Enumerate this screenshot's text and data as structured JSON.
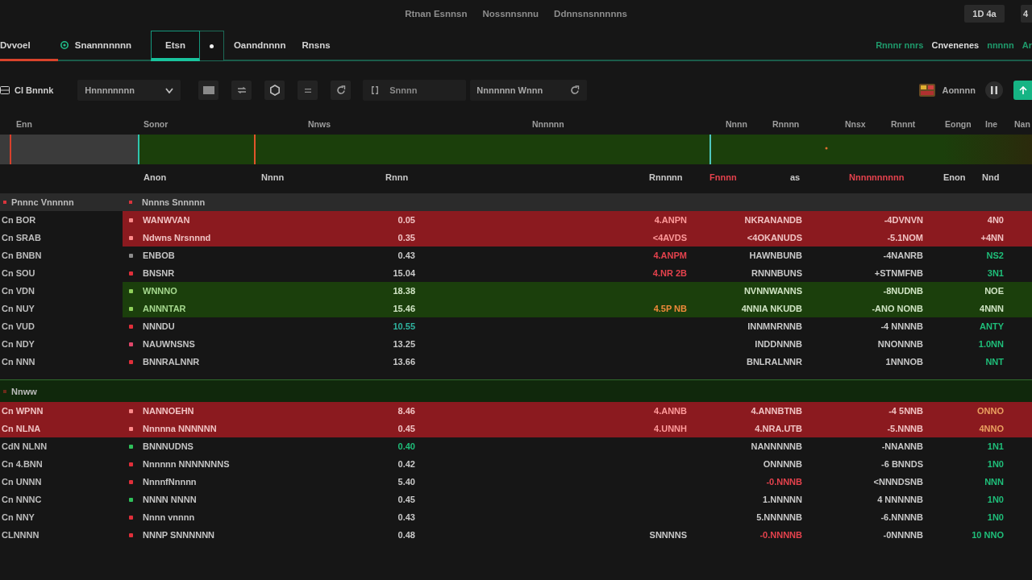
{
  "top_bar": {
    "links": [
      "Rtnan Esnnsn",
      "Nossnnsnnu",
      "Ddnnsnsnnnnns"
    ],
    "buttons": [
      "1D 4a",
      "4"
    ]
  },
  "tabs": [
    {
      "label": "Dvvoel",
      "selected": false,
      "alert": true,
      "kind": "plain"
    },
    {
      "label": "Snannnnnnn",
      "selected": false,
      "alert": false,
      "kind": "icon"
    },
    {
      "label": "Etsn",
      "selected": true,
      "alert": false,
      "kind": "plain"
    },
    {
      "label": "Oanndnnnn",
      "selected": false,
      "alert": false,
      "kind": "plain"
    },
    {
      "label": "Rnsns",
      "selected": false,
      "alert": false,
      "kind": "plain"
    }
  ],
  "view_links": [
    {
      "label": "Rnnnr nnrs",
      "selected": false
    },
    {
      "label": "Cnvenenes",
      "selected": true
    },
    {
      "label": "nnnnn",
      "selected": false
    },
    {
      "label": "Ar",
      "selected": false
    }
  ],
  "toolbar": {
    "account": "Cl Bnnnk",
    "dropdown": "Hnnnnnnnn",
    "search": {
      "placeholder": "Snnnn"
    },
    "filter": {
      "value": "Nnnnnnn Wnnn"
    },
    "user": "Aonnnn"
  },
  "table": {
    "columns": [
      "Enn",
      "Sonor",
      "Nnws",
      "Nnnnnn",
      "Nnnn",
      "Rnnnn",
      "Nnsx",
      "Rnnnt",
      "Eongn",
      "Ine",
      "Nan"
    ],
    "summary": [
      {
        "text": "Anon",
        "color": "#c9c9c9"
      },
      {
        "text": "Nnnn",
        "color": "#c9c9c9"
      },
      {
        "text": "Rnnn",
        "color": "#c9c9c9"
      },
      {
        "text": "Rnnnnn",
        "color": "#c9c9c9"
      },
      {
        "text": "Fnnnn",
        "color": "#e5424d"
      },
      {
        "text": "as",
        "color": "#c9c9c9"
      },
      {
        "text": "Nnnnnnnnnn",
        "color": "#e5424d"
      },
      {
        "text": "Enon",
        "color": "#c9c9c9"
      },
      {
        "text": "Nnd",
        "color": "#c9c9c9"
      }
    ],
    "groups": [
      {
        "kind": "split",
        "labels": [
          {
            "text": "Pnnnc Vnnnnn",
            "color": "#d9343c"
          },
          {
            "text": "Nnnns Snnnnn",
            "color": "#d9343c"
          }
        ],
        "rows": [
          {
            "kind": "loss",
            "col_1": "Cn BOR",
            "col_2": "WANWVAN",
            "color": "#ff8a8a",
            "col_3": {
              "text": "0.05",
              "color": "#f0c3c3"
            },
            "col_4": {
              "text": "4.ANPN",
              "color": "#ff9a9a"
            },
            "col_5": {
              "text": "NKRANANDB",
              "color": "#f0c3c3"
            },
            "col_6": {
              "text": "-4DVNVN",
              "color": "#f0c3c3"
            },
            "col_7": {
              "text": "4N0",
              "color": "#f0c3c3"
            }
          },
          {
            "kind": "loss",
            "col_1": "Cn SRAB",
            "col_2": "Ndwns Nrsnnnd",
            "color": "#ff8a8a",
            "col_3": {
              "text": "0.35",
              "color": "#f0c3c3"
            },
            "col_4": {
              "text": "<4AVDS",
              "color": "#ff9a9a"
            },
            "col_5": {
              "text": "<4OKANUDS",
              "color": "#f0c3c3"
            },
            "col_6": {
              "text": "-5.1NOM",
              "color": "#f0c3c3"
            },
            "col_7": {
              "text": "+4NN",
              "color": "#f0c3c3"
            }
          },
          {
            "kind": "plain",
            "col_1": "Cn BNBN",
            "col_2": "ENBOB",
            "color": "#8c8c8c",
            "col_3": {
              "text": "0.43",
              "color": "#c9c9c9"
            },
            "col_4": {
              "text": "4.ANPM",
              "color": "#e5424d"
            },
            "col_5": {
              "text": "HAWNBUNB",
              "color": "#c9c9c9"
            },
            "col_6": {
              "text": "-4NANRB",
              "color": "#c9c9c9"
            },
            "col_7": {
              "text": "NS2",
              "color": "#1fbf7a"
            }
          },
          {
            "kind": "plain",
            "col_1": "Cn SOU",
            "col_2": "BNSNR",
            "color": "#e02f3a",
            "col_3": {
              "text": "15.04",
              "color": "#c9c9c9"
            },
            "col_4": {
              "text": "4.NR 2B",
              "color": "#e5424d"
            },
            "col_5": {
              "text": "RNNNBUNS",
              "color": "#c9c9c9"
            },
            "col_6": {
              "text": "+STNMFNB",
              "color": "#c9c9c9"
            },
            "col_7": {
              "text": "3N1",
              "color": "#1fbf7a"
            }
          },
          {
            "kind": "gain",
            "col_1": "Cn VDN",
            "col_2": "WNNNO",
            "color": "#8fd05a",
            "col_3": {
              "text": "18.38",
              "color": "#d0e4c4"
            },
            "col_5": {
              "text": "NVNNWANNS",
              "color": "#d0e4c4"
            },
            "col_6": {
              "text": "-8NUDNB",
              "color": "#d0e4c4"
            },
            "col_7": {
              "text": "NOE",
              "color": "#d0e4c4"
            }
          },
          {
            "kind": "gain",
            "col_1": "Cn NUY",
            "col_2": "ANNNTAR",
            "color": "#8fd05a",
            "col_3": {
              "text": "15.46",
              "color": "#d0e4c4"
            },
            "col_4": {
              "text": "4.5P NB",
              "color": "#f08a3a"
            },
            "col_5": {
              "text": "4NNIA NKUDB",
              "color": "#d0e4c4"
            },
            "col_6": {
              "text": "-ANO NONB",
              "color": "#d0e4c4"
            },
            "col_7": {
              "text": "4NNN",
              "color": "#d0e4c4"
            }
          },
          {
            "kind": "plain",
            "col_1": "Cn VUD",
            "col_2": "NNNDU",
            "color": "#e02f3a",
            "col_3": {
              "text": "10.55",
              "color": "#2fb4a0"
            },
            "col_5": {
              "text": "INNMNRNNB",
              "color": "#c9c9c9"
            },
            "col_6": {
              "text": "-4 NNNNB",
              "color": "#c9c9c9"
            },
            "col_7": {
              "text": "ANTY",
              "color": "#1fbf7a"
            }
          },
          {
            "kind": "plain",
            "col_1": "Cn NDY",
            "col_2": "NAUWNSNS",
            "color": "#e0476a",
            "col_3": {
              "text": "13.25",
              "color": "#c9c9c9"
            },
            "col_5": {
              "text": "INDDNNNB",
              "color": "#c9c9c9"
            },
            "col_6": {
              "text": "NNONNNB",
              "color": "#c9c9c9"
            },
            "col_7": {
              "text": "1.0NN",
              "color": "#1fbf7a"
            }
          },
          {
            "kind": "plain",
            "col_1": "Cn NNN",
            "col_2": "BNNRALNNR",
            "color": "#e02f3a",
            "col_3": {
              "text": "13.66",
              "color": "#c9c9c9"
            },
            "col_5": {
              "text": "BNLRALNNR",
              "color": "#c9c9c9"
            },
            "col_6": {
              "text": "1NNNOB",
              "color": "#c9c9c9"
            },
            "col_7": {
              "text": "NNT",
              "color": "#1fbf7a"
            }
          }
        ]
      },
      {
        "kind": "full",
        "labels": [
          {
            "text": "Nnww",
            "color": "#6a2a1a"
          }
        ],
        "rows": [
          {
            "kind": "loss",
            "col_1": "Cn WPNN",
            "col_2": "NANNOEHN",
            "color": "#ff8a8a",
            "col_3": {
              "text": "8.46",
              "color": "#f0c3c3"
            },
            "col_4": {
              "text": "4.ANNB",
              "color": "#ff9a9a"
            },
            "col_5": {
              "text": "4.ANNBTNB",
              "color": "#f0c3c3"
            },
            "col_6": {
              "text": "-4 5NNB",
              "color": "#f0c3c3"
            },
            "col_7": {
              "text": "ONNO",
              "color": "#eaa060"
            }
          },
          {
            "kind": "loss",
            "col_1": "Cn NLNA",
            "col_2": "Nnnnna NNNNNN",
            "color": "#ff8a8a",
            "col_3": {
              "text": "0.45",
              "color": "#f0c3c3"
            },
            "col_4": {
              "text": "4.UNNH",
              "color": "#ff9a9a"
            },
            "col_5": {
              "text": "4.NRA.UTB",
              "color": "#f0c3c3"
            },
            "col_6": {
              "text": "-5.NNNB",
              "color": "#f0c3c3"
            },
            "col_7": {
              "text": "4NNO",
              "color": "#eaa060"
            }
          },
          {
            "kind": "plain",
            "col_1": "CdN NLNN",
            "col_2": "BNNNUDNS",
            "color": "#2fc05a",
            "col_3": {
              "text": "0.40",
              "color": "#1fbf7a"
            },
            "col_5": {
              "text": "NANNNNNB",
              "color": "#c9c9c9"
            },
            "col_6": {
              "text": "-NNANNB",
              "color": "#c9c9c9"
            },
            "col_7": {
              "text": "1N1",
              "color": "#1fbf7a"
            }
          },
          {
            "kind": "plain",
            "col_1": "Cn 4.BNN",
            "col_2": "Nnnnnn NNNNNNNS",
            "color": "#e02f3a",
            "col_3": {
              "text": "0.42",
              "color": "#c9c9c9"
            },
            "col_5": {
              "text": "ONNNNB",
              "color": "#c9c9c9"
            },
            "col_6": {
              "text": "-6 BNNDS",
              "color": "#c9c9c9"
            },
            "col_7": {
              "text": "1N0",
              "color": "#1fbf7a"
            }
          },
          {
            "kind": "plain",
            "col_1": "Cn UNNN",
            "col_2": "NnnnfNnnnn",
            "color": "#e02f3a",
            "col_3": {
              "text": "5.40",
              "color": "#c9c9c9"
            },
            "col_5": {
              "text": "-0.NNNB",
              "color": "#e5424d"
            },
            "col_6": {
              "text": "<NNNDSNB",
              "color": "#c9c9c9"
            },
            "col_7": {
              "text": "NNN",
              "color": "#1fbf7a"
            }
          },
          {
            "kind": "plain",
            "col_1": "Cn NNNC",
            "col_2": "NNNN NNNN",
            "color": "#2fc05a",
            "col_3": {
              "text": "0.45",
              "color": "#c9c9c9"
            },
            "col_5": {
              "text": "1.NNNNN",
              "color": "#c9c9c9"
            },
            "col_6": {
              "text": "4 NNNNNB",
              "color": "#c9c9c9"
            },
            "col_7": {
              "text": "1N0",
              "color": "#1fbf7a"
            }
          },
          {
            "kind": "plain",
            "col_1": "Cn NNY",
            "col_2": "Nnnn vnnnn",
            "color": "#e02f3a",
            "col_3": {
              "text": "0.43",
              "color": "#c9c9c9"
            },
            "col_5": {
              "text": "5.NNNNNB",
              "color": "#c9c9c9"
            },
            "col_6": {
              "text": "-6.NNNNB",
              "color": "#c9c9c9"
            },
            "col_7": {
              "text": "1N0",
              "color": "#1fbf7a"
            }
          },
          {
            "kind": "plain",
            "col_1": "CLNNNN",
            "col_2": "NNNP SNNNNNN",
            "color": "#e02f3a",
            "col_3": {
              "text": "0.48",
              "color": "#c9c9c9"
            },
            "col_4": {
              "text": "SNNNNS",
              "color": "#c9c9c9"
            },
            "col_5": {
              "text": "-0.NNNNB",
              "color": "#e5424d"
            },
            "col_6": {
              "text": "-0NNNNB",
              "color": "#c9c9c9"
            },
            "col_7": {
              "text": "10 NNO",
              "color": "#1fbf7a"
            }
          }
        ]
      }
    ]
  }
}
